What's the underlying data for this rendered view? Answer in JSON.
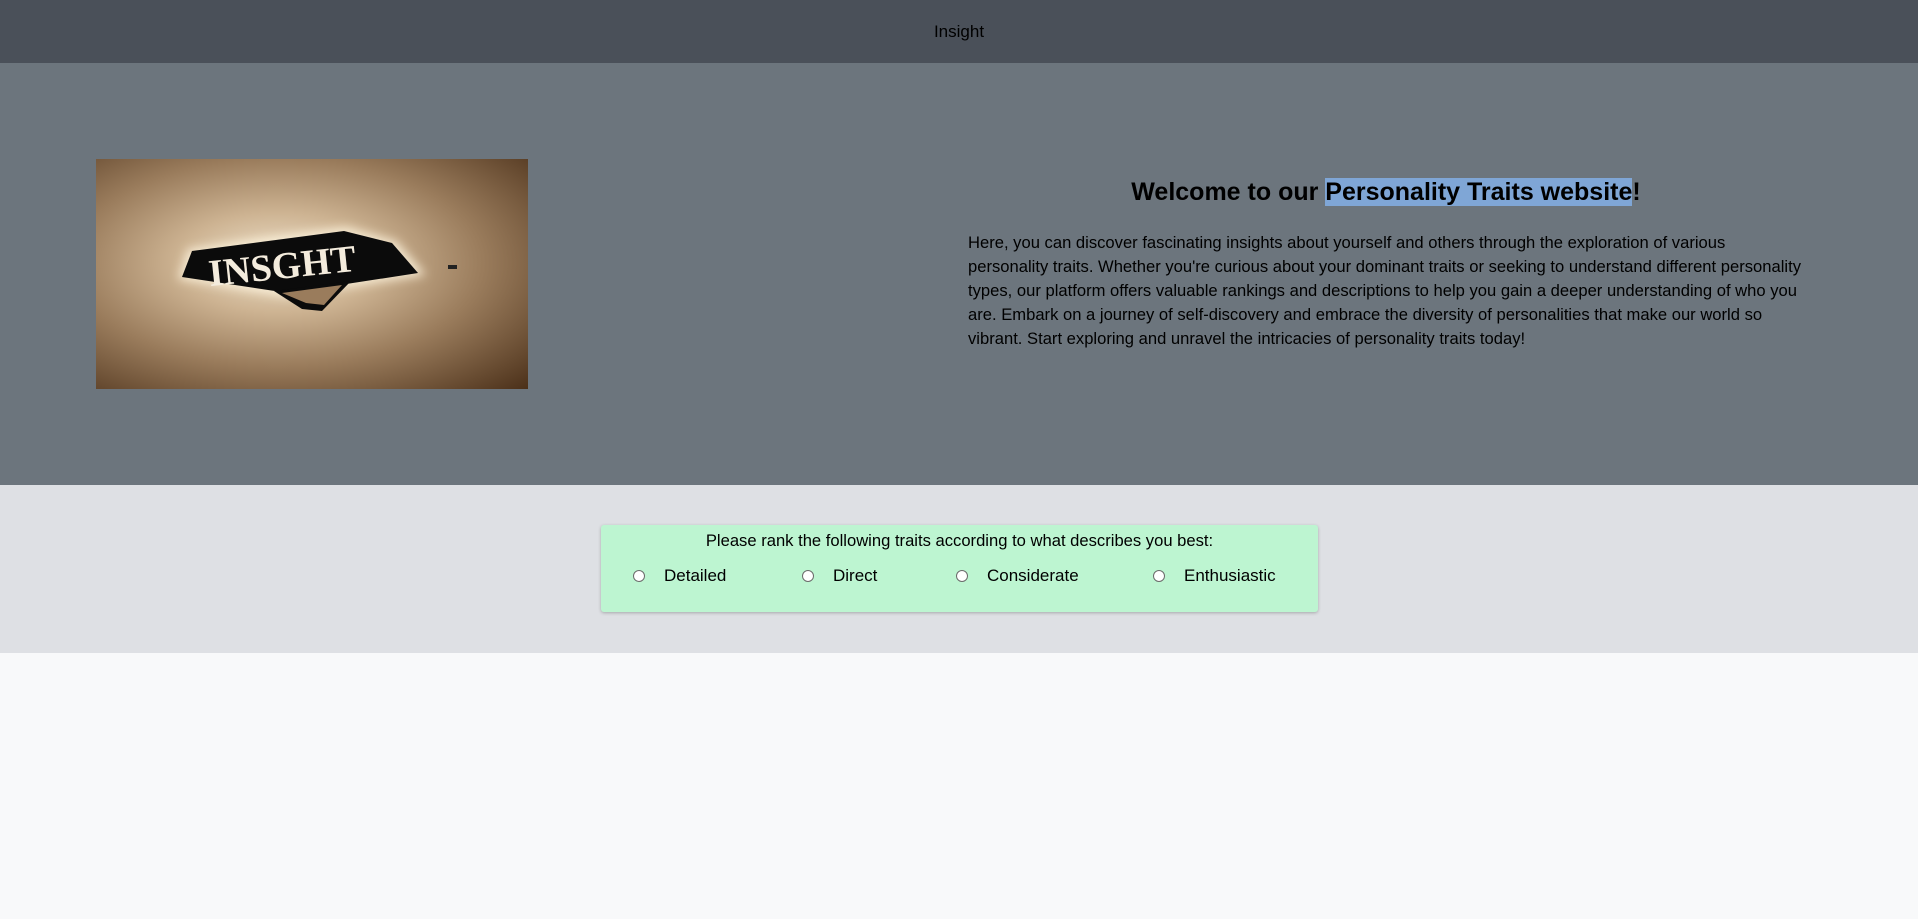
{
  "header": {
    "title": "Insight"
  },
  "hero": {
    "image_alt": "Insight logo",
    "logo_text": "INSGHT",
    "title_prefix": "Welcome to our ",
    "title_highlight": "Personality Traits website",
    "title_suffix": "!",
    "description": "Here, you can discover fascinating insights about yourself and others through the exploration of various personality traits. Whether you're curious about your dominant traits or seeking to understand different personality types, our platform offers valuable rankings and descriptions to help you gain a deeper understanding of who you are. Embark on a journey of self-discovery and embrace the diversity of personalities that make our world so vibrant. Start exploring and unravel the intricacies of personality traits today!"
  },
  "ranking": {
    "prompt": "Please rank the following traits according to what describes you best:",
    "traits": [
      {
        "label": "Detailed"
      },
      {
        "label": "Direct"
      },
      {
        "label": "Considerate"
      },
      {
        "label": "Enthusiastic"
      }
    ]
  },
  "colors": {
    "topbar": "#4a5059",
    "hero_bg": "#6c757d",
    "rank_section_bg": "#dee0e4",
    "rank_card_bg": "#bdf5d1",
    "highlight": "#7fa6d6",
    "page_bg": "#f8f9fa"
  }
}
